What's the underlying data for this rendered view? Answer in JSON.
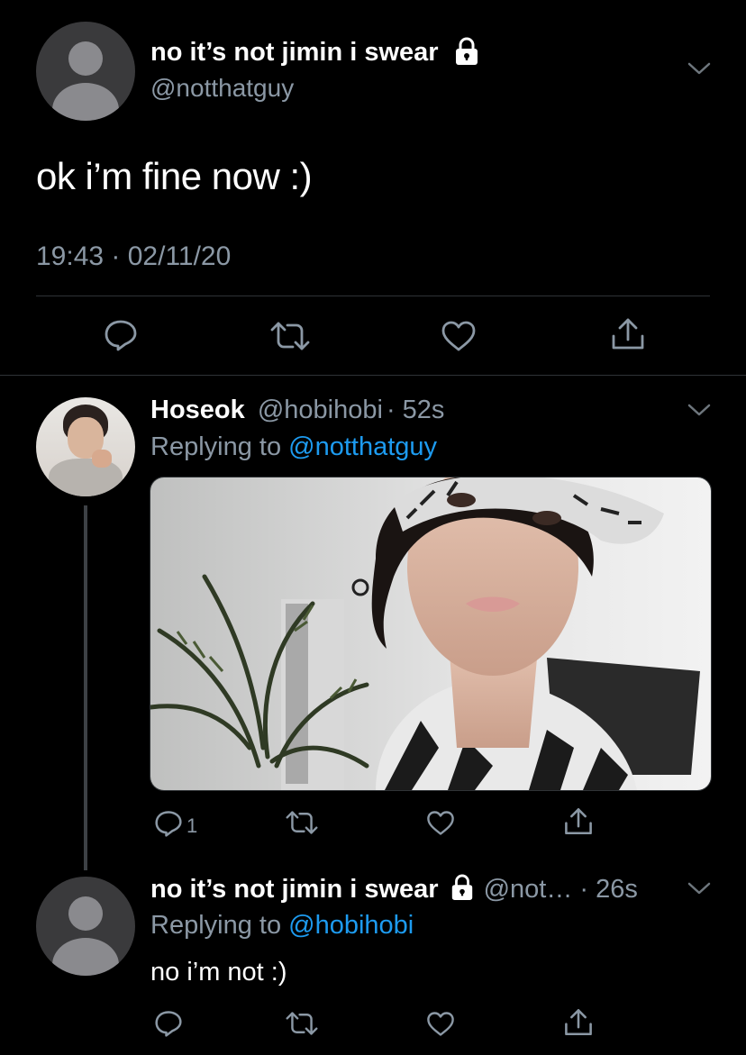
{
  "main_tweet": {
    "display_name": "no it’s not jimin i swear",
    "handle": "@notthatguy",
    "text": "ok i’m fine now :)",
    "timestamp": "19:43 · 02/11/20"
  },
  "reply1": {
    "display_name": "Hoseok",
    "handle": "@hobihobi",
    "time": "· 52s",
    "replying_prefix": "Replying to ",
    "replying_to": "@notthatguy",
    "reply_count": "1"
  },
  "reply2": {
    "display_name": "no it’s not jimin i swear",
    "handle_time": "@not… · 26s",
    "replying_prefix": "Replying to ",
    "replying_to": "@hobihobi",
    "text": "no i’m not :)"
  },
  "icons": [
    "reply-icon",
    "retweet-icon",
    "like-icon",
    "share-icon",
    "lock-icon",
    "chevron-down-icon"
  ],
  "colors": {
    "background": "#000000",
    "muted": "#8b98a5",
    "link": "#1d9bf0",
    "divider": "#2f3336"
  }
}
